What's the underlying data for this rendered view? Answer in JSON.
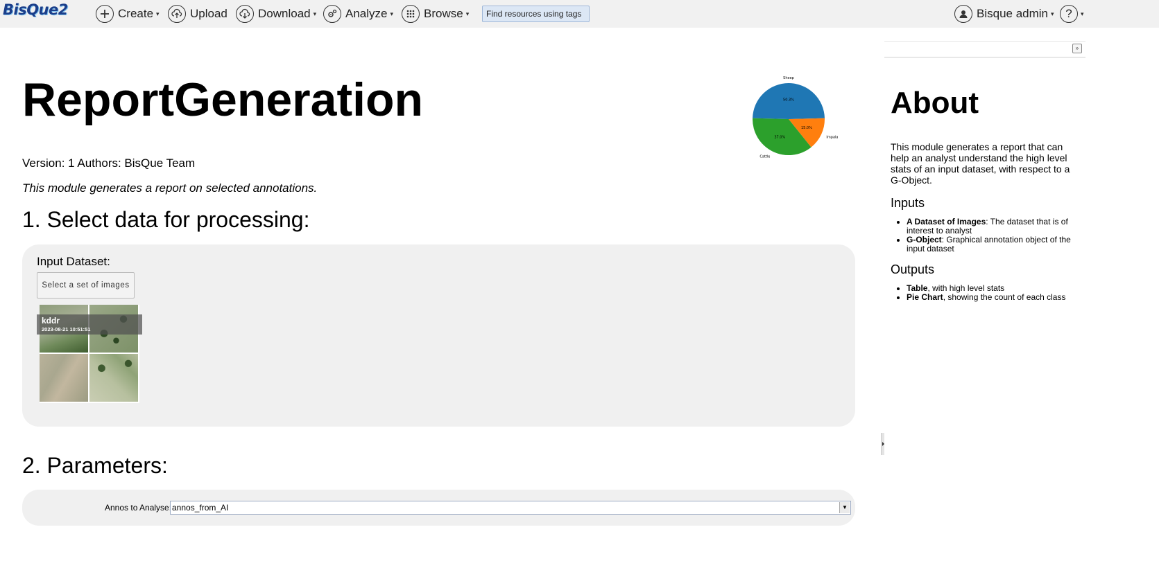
{
  "app": {
    "logo": "BisQue2"
  },
  "nav": {
    "create": "Create",
    "upload": "Upload",
    "download": "Download",
    "analyze": "Analyze",
    "browse": "Browse",
    "search_placeholder": "Find resources using tags",
    "user": "Bisque admin",
    "help": "?"
  },
  "module": {
    "title": "ReportGeneration",
    "meta": "Version: 1 Authors: BisQue Team",
    "description": "This module generates a report on selected annotations."
  },
  "section1": {
    "heading": "1. Select data for processing:",
    "input_label": "Input Dataset:",
    "select_button": "Select a set of images",
    "dataset_name": "kddr",
    "dataset_date": "2023-08-21 10:51:51"
  },
  "section2": {
    "heading": "2. Parameters:",
    "param_label": "Annos to Analyse:",
    "param_value": "annos_from_AI"
  },
  "chart_data": {
    "type": "pie",
    "labels": [
      "Sheep",
      "Impala",
      "Cattle"
    ],
    "values": [
      50.3,
      15.0,
      37.0
    ],
    "value_labels": [
      "50.3%",
      "15.0%",
      "37.0%"
    ],
    "colors": [
      "#1f77b4",
      "#ff7f0e",
      "#2ca02c"
    ]
  },
  "sidebar": {
    "heading": "About",
    "paragraph": "This module generates a report that can help an analyst understand the high level stats of an input dataset, with respect to a G-Object.",
    "inputs_heading": "Inputs",
    "inputs": [
      {
        "term": "A Dataset of Images",
        "desc": ": The dataset that is of interest to analyst"
      },
      {
        "term": "G-Object",
        "desc": ": Graphical annotation object of the input dataset"
      }
    ],
    "outputs_heading": "Outputs",
    "outputs": [
      {
        "term": "Table",
        "desc": ", with high level stats"
      },
      {
        "term": "Pie Chart",
        "desc": ", showing the count of each class"
      }
    ]
  }
}
